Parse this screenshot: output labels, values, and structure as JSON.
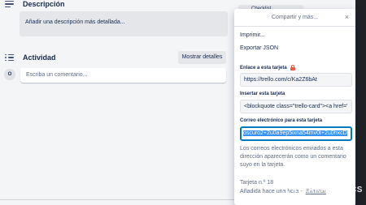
{
  "card": {
    "description": {
      "title": "Descripción",
      "placeholder": "Añadir una descripción más detallada..."
    },
    "activity": {
      "title": "Actividad",
      "show_details": "Mostrar detalles",
      "avatar_initial": "O",
      "comment_placeholder": "Escriba un comentario..."
    },
    "behind_button": "Checklist"
  },
  "share_popover": {
    "title": "Compartir y más...",
    "close": "×",
    "print": "Imprimir...",
    "export_json": "Exportar JSON",
    "link_label": "Enlace a esta tarjeta",
    "link_value": "https://trello.com/c/Ka2Z6bAt",
    "embed_label": "Insertar esta tarjeta",
    "embed_value": "<blockquote class=\"trello-card\"><a href='",
    "email_label": "Correo electrónico para esta tarjeta",
    "email_value": "oscuro2+2u0a9ep5ixna54mv0t+2u0hxcD",
    "email_help": "Los correos electrónicos enviados a esta dirección aparecerán como un comentario suyo en la tarjeta.",
    "card_number": "Tarjeta n.º 18",
    "added_text": "Añadida hace una hora -",
    "delete_link": "Eliminar"
  },
  "watermark": "XATAKA BASICS",
  "colors": {
    "accent": "#0079bf",
    "lock": "#eb5a46",
    "selection": "#3390ff"
  },
  "icons": [
    "description-icon",
    "activity-icon",
    "lock-icon",
    "close-icon",
    "xataka-logo-icon"
  ]
}
